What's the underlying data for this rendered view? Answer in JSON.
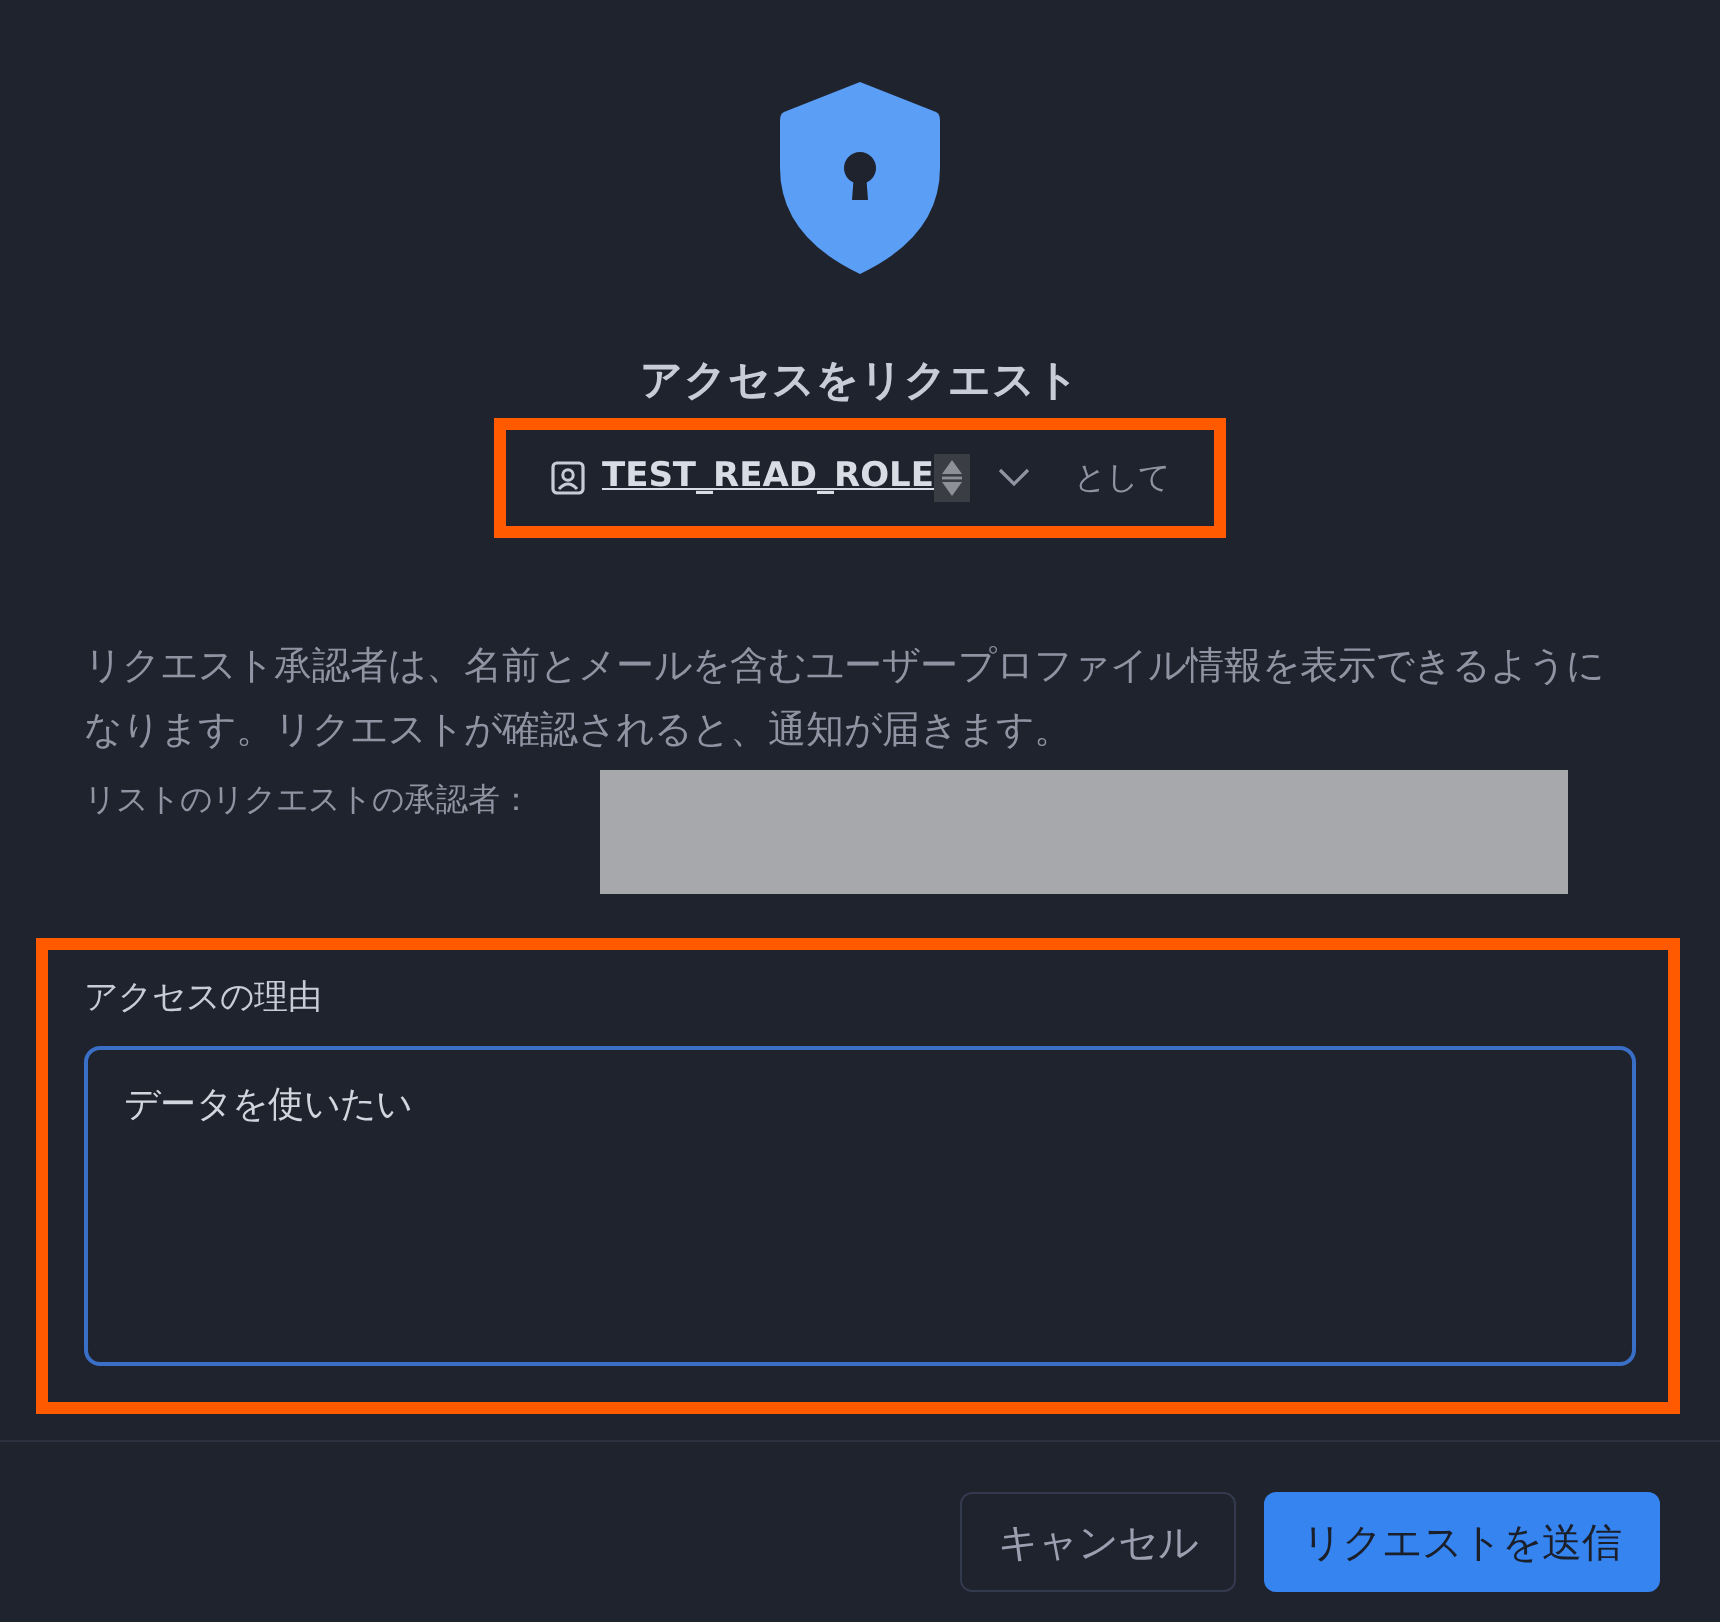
{
  "title": "アクセスをリクエスト",
  "role": {
    "name": "TEST_READ_ROLE",
    "suffix": "として"
  },
  "description": "リクエスト承認者は、名前とメールを含むユーザープロファイル情報を表示できるようになります。リクエストが確認されると、通知が届きます。",
  "approvers": {
    "label": "リストのリクエストの承認者："
  },
  "reason": {
    "label": "アクセスの理由",
    "value": "データを使いたい"
  },
  "buttons": [
    {
      "label": "キャンセル",
      "kind": "secondary"
    },
    {
      "label": "リクエストを送信",
      "kind": "primary"
    }
  ]
}
